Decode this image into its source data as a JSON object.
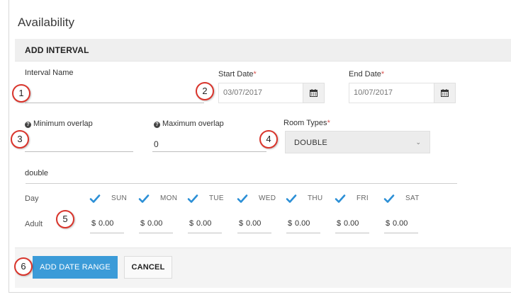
{
  "page": {
    "title": "Availability"
  },
  "card": {
    "title": "ADD INTERVAL"
  },
  "form": {
    "interval_name": {
      "label": "Interval Name",
      "value": ""
    },
    "start_date": {
      "label": "Start Date",
      "required_mark": "*",
      "placeholder": "03/07/2017"
    },
    "end_date": {
      "label": "End Date",
      "required_mark": "*",
      "placeholder": "10/07/2017"
    },
    "min_overlap": {
      "label": "Minimum overlap",
      "value": ""
    },
    "max_overlap": {
      "label": "Maximum overlap",
      "value": "0"
    },
    "room_types": {
      "label": "Room Types",
      "required_mark": "*",
      "selected": "DOUBLE"
    }
  },
  "room_section": {
    "name": "double",
    "day_row_label": "Day",
    "adult_row_label": "Adult",
    "currency": "$",
    "days": [
      {
        "label": "SUN",
        "checked": true,
        "price": "0.00"
      },
      {
        "label": "MON",
        "checked": true,
        "price": "0.00"
      },
      {
        "label": "TUE",
        "checked": true,
        "price": "0.00"
      },
      {
        "label": "WED",
        "checked": true,
        "price": "0.00"
      },
      {
        "label": "THU",
        "checked": true,
        "price": "0.00"
      },
      {
        "label": "FRI",
        "checked": true,
        "price": "0.00"
      },
      {
        "label": "SAT",
        "checked": true,
        "price": "0.00"
      }
    ]
  },
  "buttons": {
    "add_date_range": "ADD DATE RANGE",
    "cancel": "CANCEL"
  },
  "callouts": [
    "1",
    "2",
    "3",
    "4",
    "5",
    "6"
  ],
  "colors": {
    "accent": "#3b9bd8",
    "check": "#2b8fd6",
    "callout_border": "#d9342b",
    "required": "#d9534f"
  }
}
